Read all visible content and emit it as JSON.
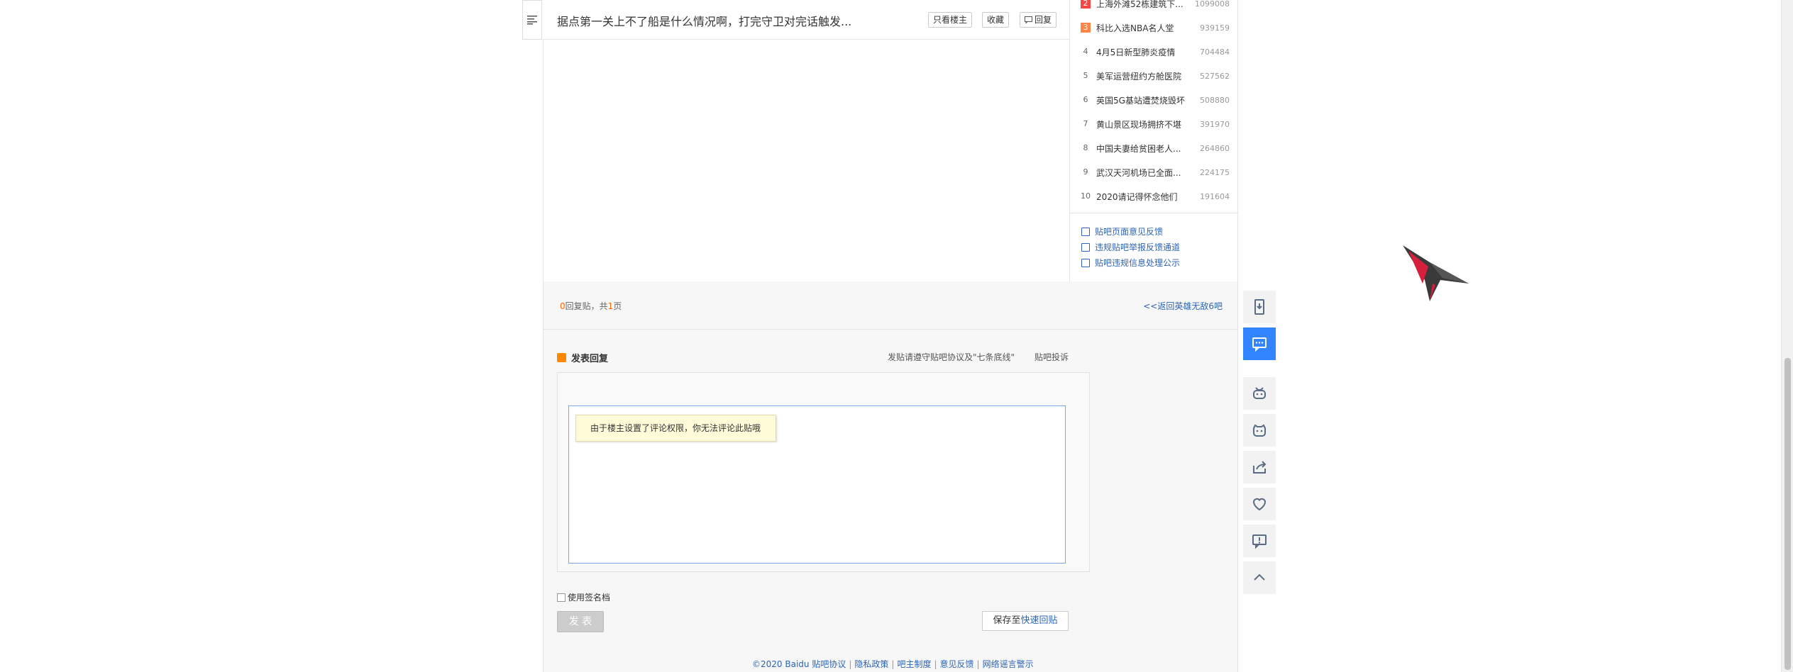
{
  "thread": {
    "title": "据点第一关上不了船是什么情况啊，打完守卫对完话触发...",
    "only_author": "只看楼主",
    "collect": "收藏",
    "reply": "回复"
  },
  "hot_list": [
    {
      "rank": "2",
      "title": "上海外滩52栋建筑下...",
      "count": "1099008"
    },
    {
      "rank": "3",
      "title": "科比入选NBA名人堂",
      "count": "939159"
    },
    {
      "rank": "4",
      "title": "4月5日新型肺炎疫情",
      "count": "704484"
    },
    {
      "rank": "5",
      "title": "美军运营纽约方舱医院",
      "count": "527562"
    },
    {
      "rank": "6",
      "title": "英国5G基站遭焚烧毁坏",
      "count": "508880"
    },
    {
      "rank": "7",
      "title": "黄山景区现场拥挤不堪",
      "count": "391970"
    },
    {
      "rank": "8",
      "title": "中国夫妻给贫困老人...",
      "count": "264860"
    },
    {
      "rank": "9",
      "title": "武汉天河机场已全面...",
      "count": "224175"
    },
    {
      "rank": "10",
      "title": "2020请记得怀念他们",
      "count": "191604"
    }
  ],
  "side_links": {
    "feedback": "贴吧页面意见反馈",
    "report": "违规贴吧举报反馈通道",
    "publicity": "贴吧违规信息处理公示"
  },
  "pager": {
    "count": "0",
    "label_reply": "回复贴，共",
    "pages": "1",
    "label_page": "页",
    "back": "<<返回英雄无敌6吧"
  },
  "reply_form": {
    "heading": "发表回复",
    "rules": "发贴请遵守贴吧协议及\"七条底线\"",
    "complaint": "贴吧投诉",
    "notice": "由于楼主设置了评论权限，你无法评论此贴哦",
    "signature": "使用签名档",
    "post": "发 表",
    "save_prefix": "保存至",
    "save_link": "快速回贴"
  },
  "footer": {
    "copyright": "©2020 Baidu",
    "links": [
      "贴吧协议",
      "隐私政策",
      "吧主制度",
      "意见反馈",
      "网络谣言警示"
    ]
  },
  "float_bar": {
    "icons": [
      "mobile-icon",
      "chat-icon",
      "robot-icon",
      "game-icon",
      "share-icon",
      "like-icon",
      "report-icon",
      "back-to-top-icon"
    ]
  },
  "colors": {
    "link": "#2d64b3",
    "accent": "#3385ff",
    "rank_top": "#f54545",
    "rank_top2": "#ff8547"
  }
}
